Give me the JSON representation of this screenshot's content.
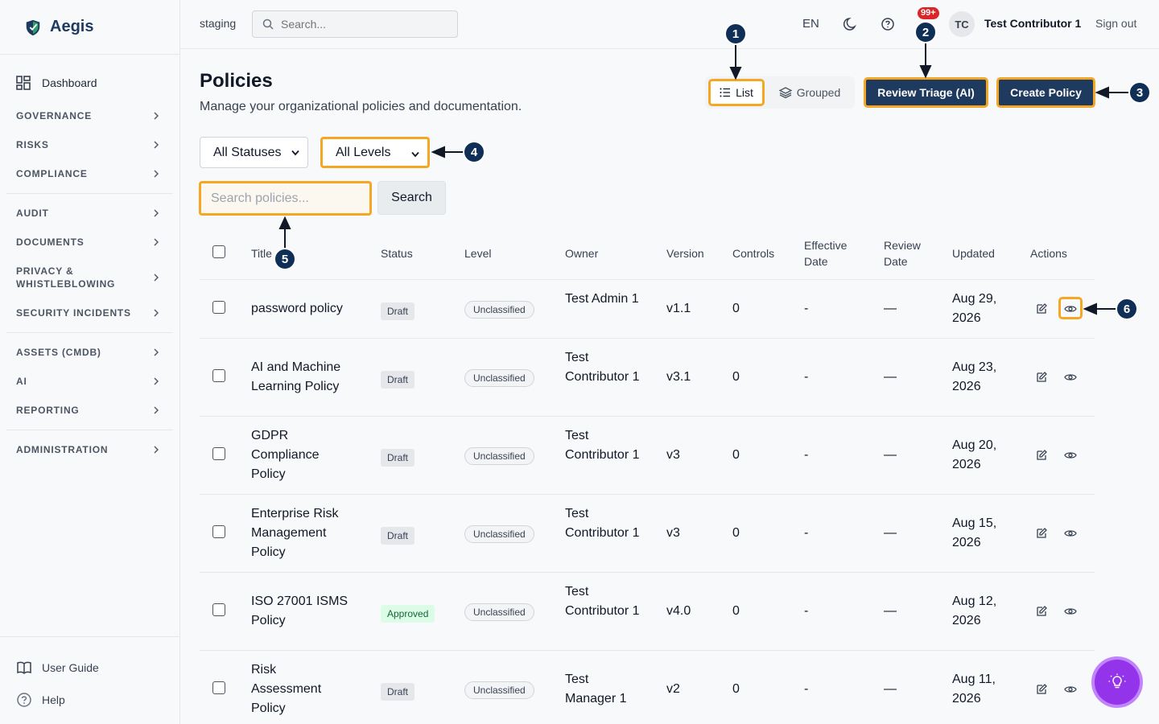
{
  "brand": {
    "name": "Aegis"
  },
  "sidebar": {
    "dashboard": "Dashboard",
    "groups": [
      [
        "GOVERNANCE",
        "RISKS",
        "COMPLIANCE"
      ],
      [
        "AUDIT",
        "DOCUMENTS",
        "PRIVACY & WHISTLEBLOWING",
        "SECURITY INCIDENTS"
      ],
      [
        "ASSETS (CMDB)",
        "AI",
        "REPORTING"
      ],
      [
        "ADMINISTRATION"
      ]
    ],
    "user_guide": "User Guide",
    "help": "Help"
  },
  "topbar": {
    "environment": "staging",
    "search_placeholder": "Search...",
    "language": "EN",
    "notifications_badge": "99+",
    "avatar_initials": "TC",
    "user_name": "Test Contributor 1",
    "sign_out": "Sign out"
  },
  "page": {
    "title": "Policies",
    "subtitle": "Manage your organizational policies and documentation.",
    "view_list": "List",
    "view_grouped": "Grouped",
    "review_triage": "Review Triage (AI)",
    "create_policy": "Create Policy",
    "status_filter": "All Statuses",
    "level_filter": "All Levels",
    "search_placeholder": "Search policies...",
    "search_button": "Search"
  },
  "table": {
    "headers": {
      "title": "Title",
      "status": "Status",
      "level": "Level",
      "owner": "Owner",
      "version": "Version",
      "controls": "Controls",
      "effective_date": "Effective Date",
      "review_date": "Review Date",
      "updated": "Updated",
      "actions": "Actions"
    },
    "rows": [
      {
        "title": "password policy",
        "status": "Draft",
        "level": "Unclassified",
        "owner": "Test Admin 1",
        "version": "v1.1",
        "controls": "0",
        "effective": "-",
        "review": "—",
        "updated": "Aug 29, 2026"
      },
      {
        "title": "AI and Machine Learning Policy",
        "status": "Draft",
        "level": "Unclassified",
        "owner": "Test Contributor 1",
        "version": "v3.1",
        "controls": "0",
        "effective": "-",
        "review": "—",
        "updated": "Aug 23, 2026"
      },
      {
        "title": "GDPR Compliance Policy",
        "status": "Draft",
        "level": "Unclassified",
        "owner": "Test Contributor 1",
        "version": "v3",
        "controls": "0",
        "effective": "-",
        "review": "—",
        "updated": "Aug 20, 2026"
      },
      {
        "title": "Enterprise Risk Management Policy",
        "status": "Draft",
        "level": "Unclassified",
        "owner": "Test Contributor 1",
        "version": "v3",
        "controls": "0",
        "effective": "-",
        "review": "—",
        "updated": "Aug 15, 2026"
      },
      {
        "title": "ISO 27001 ISMS Policy",
        "status": "Approved",
        "level": "Unclassified",
        "owner": "Test Contributor 1",
        "version": "v4.0",
        "controls": "0",
        "effective": "-",
        "review": "—",
        "updated": "Aug 12, 2026"
      },
      {
        "title": "Risk Assessment Policy",
        "status": "Draft",
        "level": "Unclassified",
        "owner": "Test Manager 1",
        "version": "v2",
        "controls": "0",
        "effective": "-",
        "review": "—",
        "updated": "Aug 11, 2026"
      }
    ]
  },
  "callouts": [
    "1",
    "2",
    "3",
    "4",
    "5",
    "6"
  ],
  "colors": {
    "primary": "#1e3a5f",
    "highlight": "#f5a623",
    "callout": "#0f2f57",
    "fab": "#9333ea"
  }
}
